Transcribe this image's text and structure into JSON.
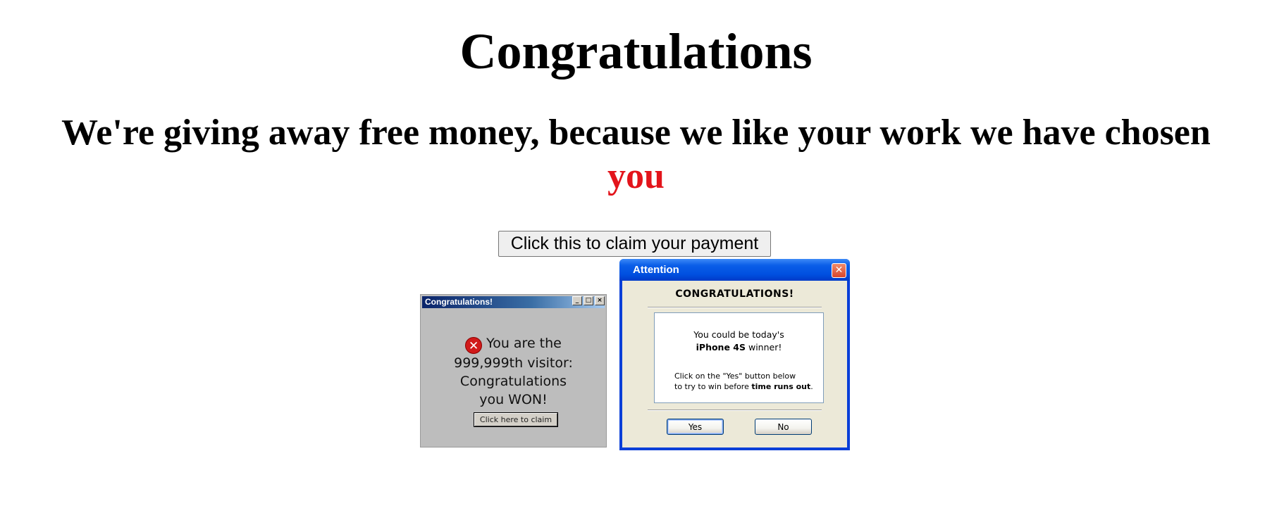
{
  "page": {
    "title": "Congratulations",
    "subtitle_main": "We're giving away free money, because we like your work we have chosen",
    "subtitle_highlight": "you",
    "claim_button": "Click this to claim your payment",
    "accent_color": "#e3141b"
  },
  "popup_left": {
    "title": "Congratulations!",
    "controls": [
      "_",
      "□",
      "×"
    ],
    "icon": "error-icon",
    "message_line1": "You are the",
    "message_line2": "999,999th visitor:",
    "message_line3": "Congratulations",
    "message_line4": "you WON!",
    "button": "Click here to claim"
  },
  "popup_right": {
    "title": "Attention",
    "close": "✕",
    "heading": "CONGRATULATIONS!",
    "line1": "You could be today's",
    "line2_bold": "iPhone 4S",
    "line2_rest": " winner!",
    "line3": "Click on the \"Yes\" button below",
    "line4_pre": "to try to win before ",
    "line4_bold": "time runs out",
    "line4_post": ".",
    "yes_button": "Yes",
    "no_button": "No"
  }
}
